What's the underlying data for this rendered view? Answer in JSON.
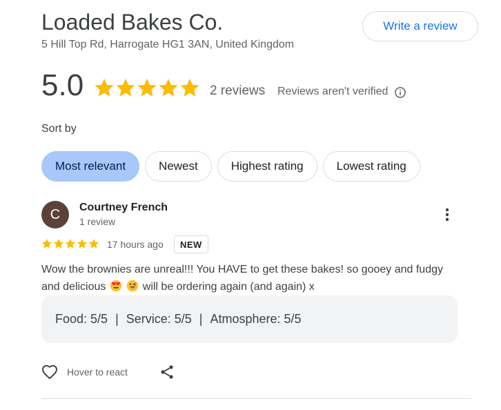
{
  "business": {
    "name": "Loaded Bakes Co.",
    "address": "5 Hill Top Rd, Harrogate HG1 3AN, United Kingdom",
    "write_review_label": "Write a review"
  },
  "summary": {
    "rating": "5.0",
    "stars": 5,
    "review_count": "2 reviews",
    "unverified_text": "Reviews aren't verified",
    "star_color": "#fbbc04"
  },
  "sort": {
    "label": "Sort by",
    "options": [
      "Most relevant",
      "Newest",
      "Highest rating",
      "Lowest rating"
    ],
    "selected": "Most relevant"
  },
  "review": {
    "avatar_letter": "C",
    "avatar_color": "#5d4037",
    "author": "Courtney French",
    "author_meta": "1 review",
    "stars": 5,
    "time": "17 hours ago",
    "badge": "NEW",
    "text_part1": "Wow the brownies are unreal!!! You HAVE to get these bakes! so gooey and fudgy and delicious",
    "emojis": [
      "smiling-face-with-heart-eyes",
      "winking-face-with-tongue"
    ],
    "text_part2": "will be ordering again (and again) x",
    "attributes": {
      "food": "Food: 5/5",
      "service": "Service: 5/5",
      "atmosphere": "Atmosphere: 5/5",
      "separator": "|"
    },
    "react_label": "Hover to react"
  }
}
